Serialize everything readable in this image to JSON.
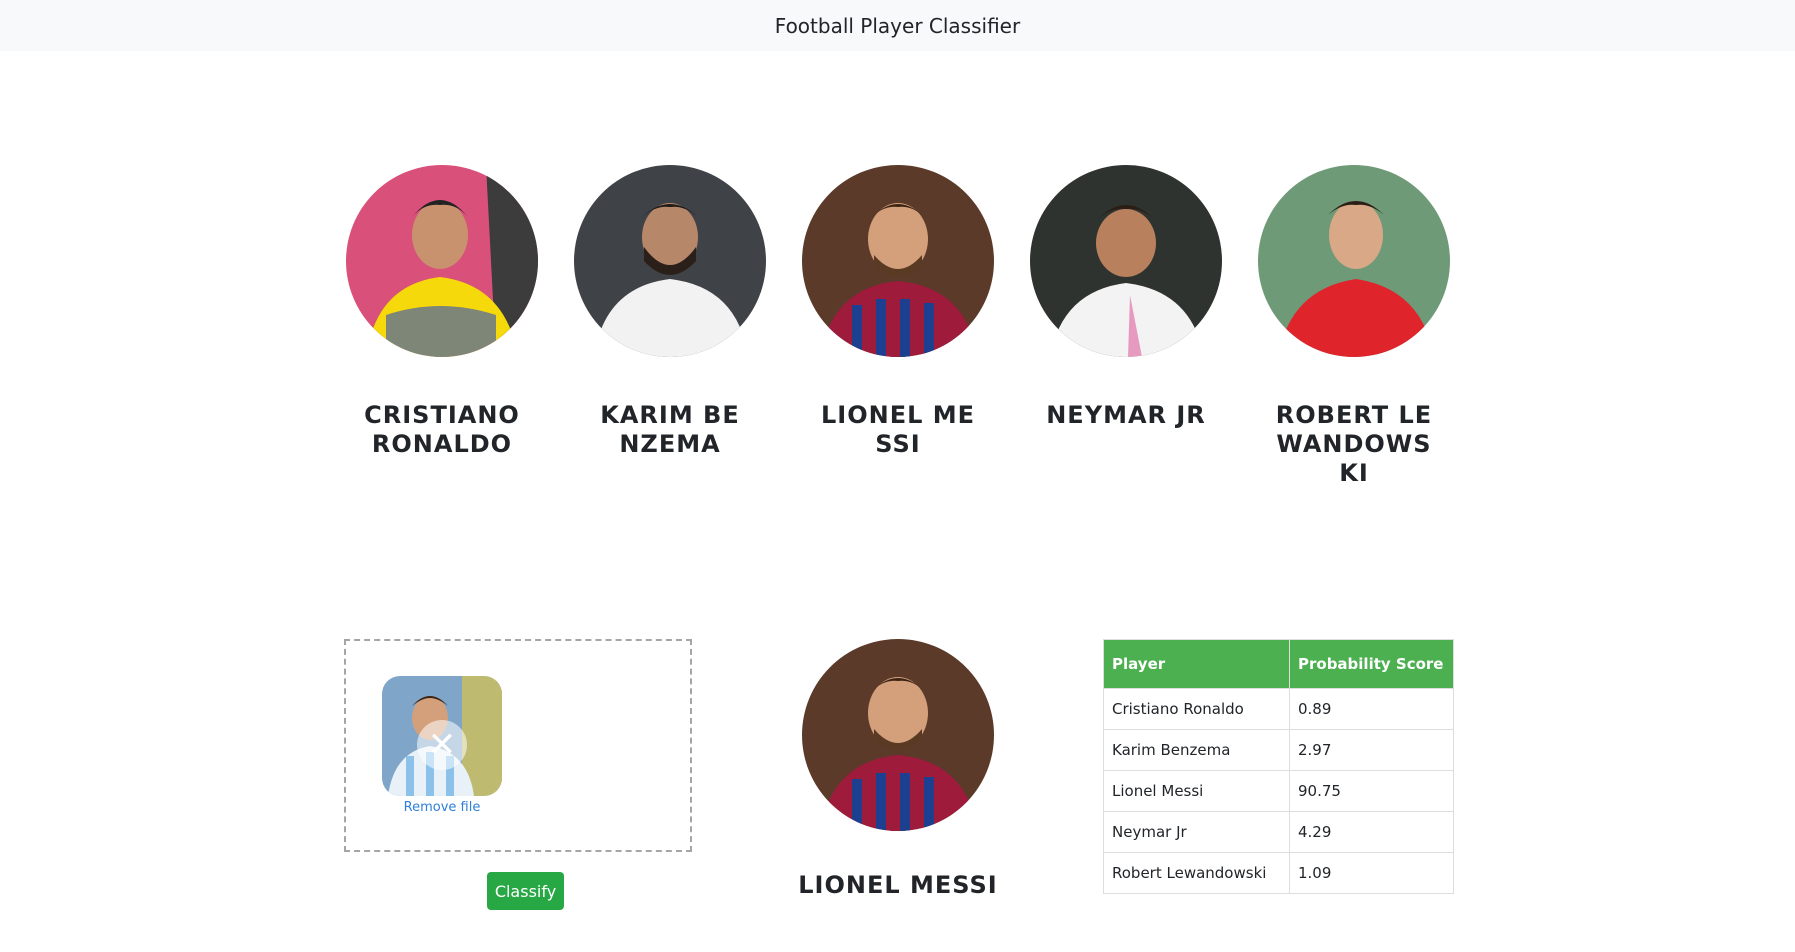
{
  "navbar": {
    "title": "Football Player Classifier"
  },
  "players": [
    {
      "name": "Cristiano Ronaldo",
      "icon": "player-photo-icon",
      "bg": "#d9507a",
      "shirt": "#f5d90a"
    },
    {
      "name": "Karim Benzema",
      "icon": "player-photo-icon",
      "bg": "#3f4347",
      "shirt": "#f2f2f2"
    },
    {
      "name": "Lionel Messi",
      "icon": "player-photo-icon",
      "bg": "#5b3a2a",
      "shirt": "#9e1b3b"
    },
    {
      "name": "Neymar Jr",
      "icon": "player-photo-icon",
      "bg": "#2f3330",
      "shirt": "#f3f3f3"
    },
    {
      "name": "Robert Lewandowski",
      "icon": "player-photo-icon",
      "bg": "#6f9a78",
      "shirt": "#e0242c"
    }
  ],
  "upload": {
    "remove_label": "Remove file",
    "classify_label": "Classify"
  },
  "result": {
    "name": "Lionel Messi"
  },
  "table": {
    "headers": [
      "Player",
      "Probability Score"
    ],
    "rows": [
      [
        "Cristiano Ronaldo",
        "0.89"
      ],
      [
        "Karim Benzema",
        "2.97"
      ],
      [
        "Lionel Messi",
        "90.75"
      ],
      [
        "Neymar Jr",
        "4.29"
      ],
      [
        "Robert Lewandowski",
        "1.09"
      ]
    ]
  },
  "colors": {
    "accent": "#28a745",
    "table_header": "#4caf50",
    "link": "#2e7fd8"
  }
}
